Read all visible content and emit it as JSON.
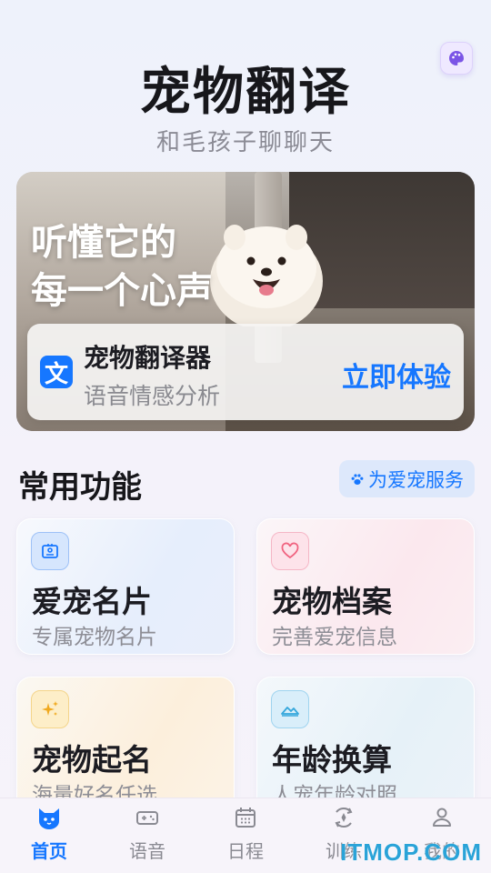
{
  "header": {
    "title": "宠物翻译",
    "subtitle": "和毛孩子聊聊天",
    "theme_icon": "palette-icon"
  },
  "banner": {
    "headline_line1": "听懂它的",
    "headline_line2": "每一个心声",
    "card": {
      "icon_glyph": "文",
      "title": "宠物翻译器",
      "subtitle": "语音情感分析",
      "cta": "立即体验"
    }
  },
  "section": {
    "title": "常用功能",
    "tag": "为爱宠服务",
    "tag_icon": "paw-icon"
  },
  "features": [
    {
      "name": "爱宠名片",
      "desc": "专属宠物名片",
      "icon": "id-card-icon",
      "color": "#1677ff"
    },
    {
      "name": "宠物档案",
      "desc": "完善爱宠信息",
      "icon": "heart-icon",
      "color": "#f0627f"
    },
    {
      "name": "宠物起名",
      "desc": "海量好名任选",
      "icon": "sparkle-icon",
      "color": "#f0a91e"
    },
    {
      "name": "年龄换算",
      "desc": "人宠年龄对照",
      "icon": "mountain-icon",
      "color": "#35a7dc"
    }
  ],
  "tabbar": [
    {
      "label": "首页",
      "icon": "cat-icon",
      "active": true
    },
    {
      "label": "语音",
      "icon": "gamepad-icon",
      "active": false
    },
    {
      "label": "日程",
      "icon": "calendar-icon",
      "active": false
    },
    {
      "label": "训练",
      "icon": "training-icon",
      "active": false
    },
    {
      "label": "我的",
      "icon": "user-icon",
      "active": false
    }
  ],
  "colors": {
    "accent": "#1677ff",
    "inactive": "#8a8a92"
  },
  "watermark": "ITMOP.COM"
}
